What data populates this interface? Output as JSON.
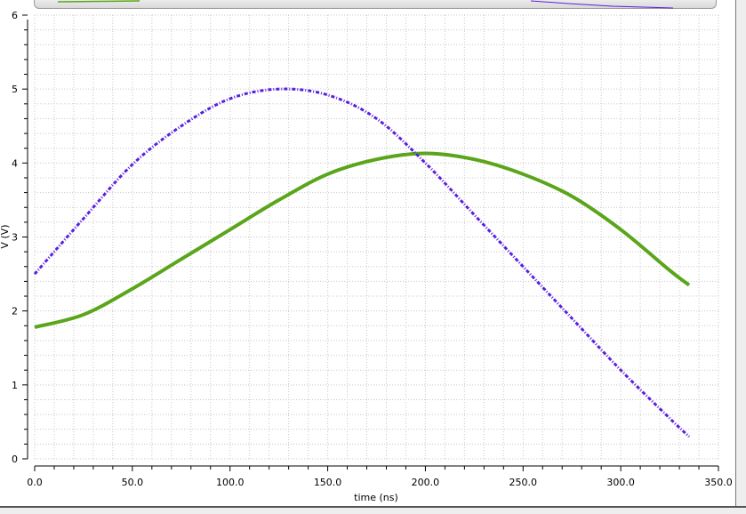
{
  "chart_data": {
    "type": "line",
    "xlabel": "time (ns)",
    "ylabel": "V (V)",
    "xlim": [
      0,
      350
    ],
    "ylim": [
      0,
      6
    ],
    "x_ticks": [
      "0.0",
      "50.0",
      "100.0",
      "150.0",
      "200.0",
      "250.0",
      "300.0",
      "350.0"
    ],
    "y_ticks": [
      "0",
      "1",
      "2",
      "3",
      "4",
      "5",
      "6"
    ],
    "grid": true,
    "series": [
      {
        "color": "#5aa51a",
        "style": "solid",
        "x": [
          0,
          25,
          50,
          75,
          100,
          125,
          150,
          175,
          200,
          225,
          250,
          275,
          300,
          325,
          335
        ],
        "y": [
          1.78,
          1.95,
          2.3,
          2.7,
          3.1,
          3.5,
          3.85,
          4.05,
          4.13,
          4.05,
          3.85,
          3.55,
          3.1,
          2.55,
          2.35
        ]
      },
      {
        "color": "#5a1fe0",
        "style": "dashed",
        "x": [
          0,
          25,
          50,
          75,
          100,
          125,
          150,
          175,
          200,
          225,
          250,
          275,
          300,
          325,
          335
        ],
        "y": [
          2.5,
          3.25,
          3.98,
          4.5,
          4.87,
          5.0,
          4.92,
          4.6,
          4.0,
          3.3,
          2.6,
          1.9,
          1.2,
          0.55,
          0.3
        ]
      }
    ]
  }
}
